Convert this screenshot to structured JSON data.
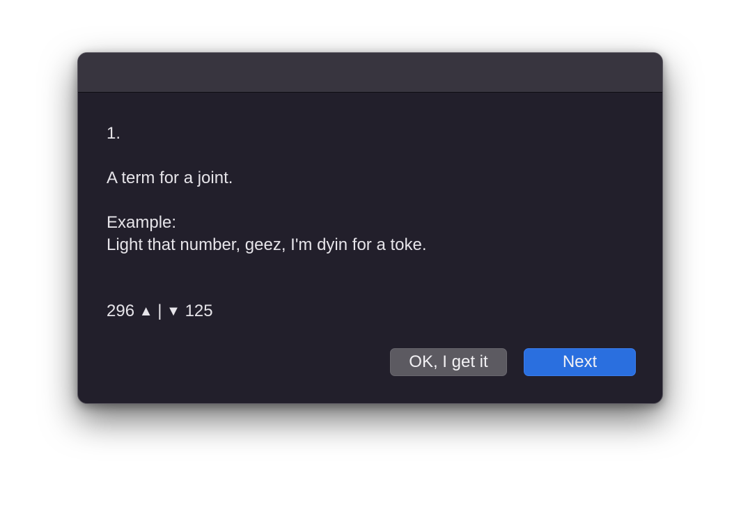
{
  "dialog": {
    "number": "1.",
    "definition": "A term for a joint.",
    "example_label": "Example:",
    "example_text": "Light that number, geez, I'm dyin for a toke.",
    "votes": {
      "up_count": "296",
      "up_symbol": "▲",
      "separator": "|",
      "down_symbol": "▼",
      "down_count": "125"
    },
    "buttons": {
      "ok_label": "OK, I get it",
      "next_label": "Next"
    }
  },
  "colors": {
    "dialog_background": "#221f2b",
    "titlebar_background": "#38353f",
    "text": "#e6e4e9",
    "ok_button": "#5c5a61",
    "next_button": "#2a6fdf"
  }
}
